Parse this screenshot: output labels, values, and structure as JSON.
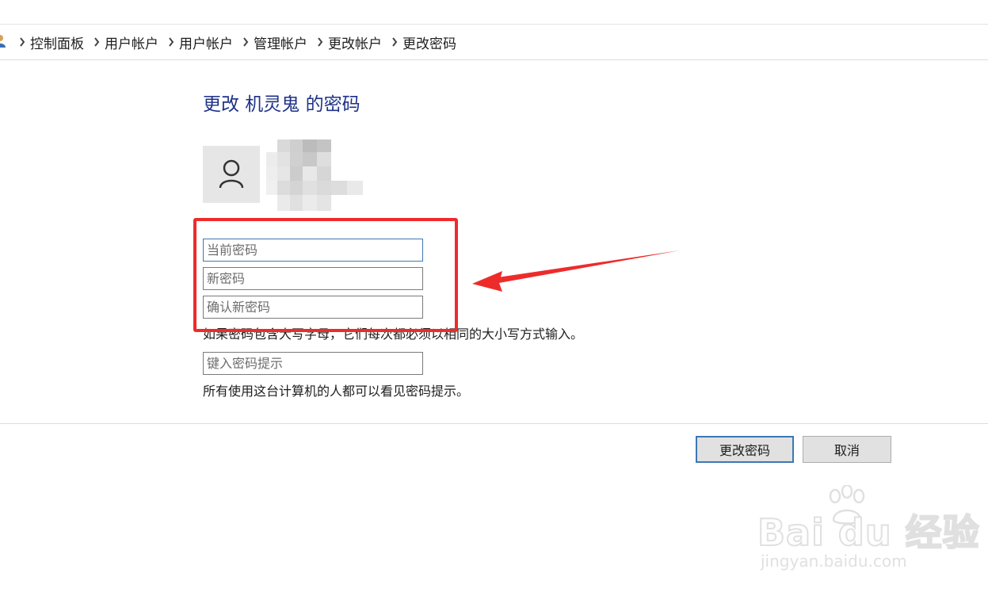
{
  "breadcrumb": {
    "items": [
      "控制面板",
      "用户帐户",
      "用户帐户",
      "管理帐户",
      "更改帐户",
      "更改密码"
    ]
  },
  "page": {
    "title": "更改 机灵鬼 的密码"
  },
  "form": {
    "current_password_placeholder": "当前密码",
    "new_password_placeholder": "新密码",
    "confirm_password_placeholder": "确认新密码",
    "case_note": "如果密码包含大写字母，它们每次都必须以相同的大小写方式输入。",
    "hint_placeholder": "键入密码提示",
    "hint_note": "所有使用这台计算机的人都可以看见密码提示。"
  },
  "buttons": {
    "change_password": "更改密码",
    "cancel": "取消"
  },
  "watermark": {
    "logo": "Bai du 经验",
    "url": "jingyan.baidu.com"
  },
  "colors": {
    "title": "#1e3287",
    "annotation": "#ee2b2b",
    "focus_border": "#3c78b4"
  }
}
